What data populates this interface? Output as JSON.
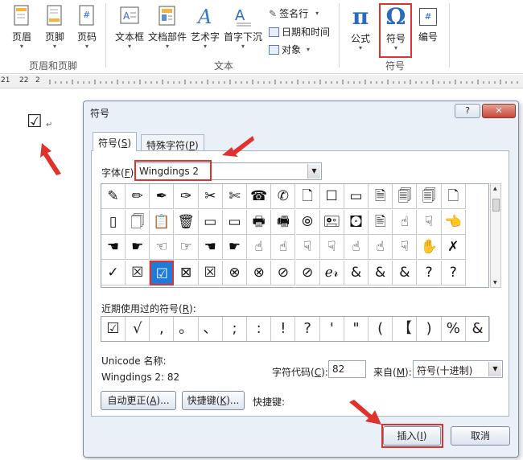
{
  "ribbon": {
    "header_footer": {
      "label": "页眉和页脚",
      "buttons": [
        "页眉",
        "页脚",
        "页码"
      ]
    },
    "text_group": {
      "label": "文本",
      "buttons": [
        "文本框",
        "文档部件",
        "艺术字",
        "首字下沉"
      ],
      "small_items": [
        "签名行",
        "日期和时间",
        "对象"
      ]
    },
    "symbols_group": {
      "label": "符号",
      "formula": "公式",
      "symbol": "符号",
      "number": "编号",
      "formula_glyph": "π",
      "symbol_glyph": "Ω",
      "number_glyph": "#"
    }
  },
  "ruler": [
    "21",
    "22",
    "2"
  ],
  "document": {
    "checkbox": "☑",
    "paragraph_mark": "↵"
  },
  "dialog": {
    "title": "符号",
    "help": "?",
    "close": "✕",
    "tabs": [
      "符号(",
      "S",
      ")",
      "特殊字符(",
      "P",
      ")"
    ],
    "font_label": [
      "字体(",
      "F",
      "):"
    ],
    "font_value": "Wingdings 2",
    "grid_rows": [
      [
        "✎",
        "✏",
        "✒",
        "✑",
        "✂",
        "✄",
        "☎",
        "✆",
        "🗋",
        "☐",
        "▭",
        "🗎",
        "🗐",
        "🗐",
        "🗋"
      ],
      [
        "▯",
        "🗍",
        "📋",
        "🗑",
        "▭",
        "▭",
        "🖶",
        "🖷",
        "⦾",
        "🖭",
        "🖸",
        "🖹",
        "☝",
        "☟",
        "👈"
      ],
      [
        "☚",
        "☛",
        "☜",
        "☞",
        "☚",
        "☛",
        "☝",
        "☝",
        "☟",
        "☟",
        "☝",
        "☝",
        "☟",
        "✋",
        "✗"
      ],
      [
        "✓",
        "☒",
        "☑",
        "⊠",
        "☒",
        "⊗",
        "⊗",
        "⊘",
        "⊘",
        "ℯ𝓇",
        "&",
        "&",
        "&",
        "?",
        "?"
      ]
    ],
    "recent_label": [
      "近期使用过的符号(",
      "R",
      "):"
    ],
    "recent": [
      "☑",
      "√",
      ",",
      "。",
      "、",
      ";",
      ":",
      "!",
      "?",
      "'",
      "\"",
      "(",
      "【",
      ")",
      "%",
      "&"
    ],
    "unicode_name_label": "Unicode 名称:",
    "unicode_name_value": "Wingdings 2: 82",
    "char_code_label": [
      "字符代码(",
      "C",
      "):"
    ],
    "char_code_value": "82",
    "from_label": [
      "来自(",
      "M",
      "):"
    ],
    "from_value": "符号(十进制)",
    "autocorrect_button": [
      "自动更正(",
      "A",
      ")..."
    ],
    "shortcut_button": [
      "快捷键(",
      "K",
      ")..."
    ],
    "shortcut_label": "快捷键:",
    "insert_button": [
      "插入(",
      "I",
      ")"
    ],
    "cancel_button": "取消"
  },
  "colors": {
    "highlight": "#e0322d",
    "selected_cell": "#1e7bd8",
    "dialog_bg": "#eaf0f8"
  }
}
